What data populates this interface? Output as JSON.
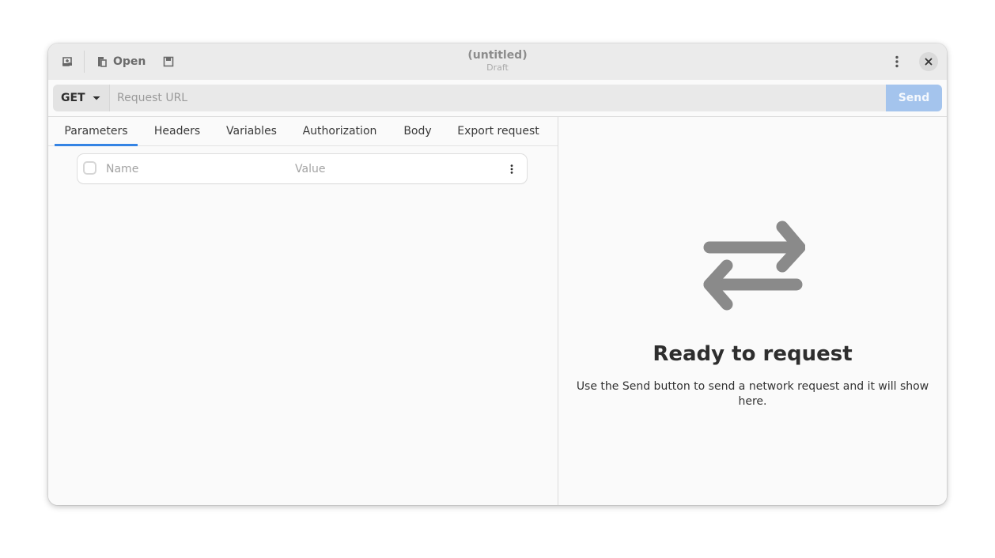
{
  "header": {
    "new_tab_icon": "new-tab-icon",
    "open_label": "Open",
    "open_icon": "document-open-icon",
    "save_icon": "save-icon",
    "title": "(untitled)",
    "subtitle": "Draft",
    "menu_icon": "vertical-dots-icon",
    "close_icon": "close-icon"
  },
  "request": {
    "method": "GET",
    "url_placeholder": "Request URL",
    "url_value": "",
    "send_label": "Send"
  },
  "tabs": [
    {
      "label": "Parameters",
      "active": true
    },
    {
      "label": "Headers",
      "active": false
    },
    {
      "label": "Variables",
      "active": false
    },
    {
      "label": "Authorization",
      "active": false
    },
    {
      "label": "Body",
      "active": false
    },
    {
      "label": "Export request",
      "active": false
    }
  ],
  "parameters": {
    "name_placeholder": "Name",
    "value_placeholder": "Value",
    "checked": false
  },
  "response": {
    "icon": "arrows-exchange-icon",
    "title": "Ready to request",
    "description": "Use the Send button to send a network request and it will show here."
  },
  "colors": {
    "accent": "#3584e4",
    "send_disabled": "#a4c4ed",
    "icon_gray": "#8a8a8a"
  }
}
